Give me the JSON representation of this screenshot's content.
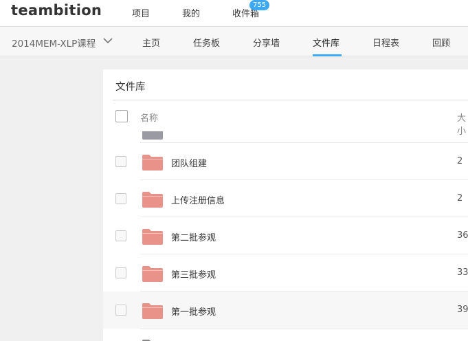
{
  "app": {
    "logo": "teambition"
  },
  "topnav": {
    "items": [
      "项目",
      "我的",
      "收件箱"
    ],
    "inbox_badge": "755"
  },
  "project": {
    "name": "2014MEM-XLP课程",
    "tabs": [
      "主页",
      "任务板",
      "分享墙",
      "文件库",
      "日程表",
      "回顾"
    ],
    "active_tab": "文件库"
  },
  "library": {
    "title": "文件库",
    "columns": {
      "name": "名称",
      "size": "大小"
    },
    "rows": [
      {
        "name": "团队组建",
        "size": "2"
      },
      {
        "name": "上传注册信息",
        "size": "2"
      },
      {
        "name": "第二批参观",
        "size": "36"
      },
      {
        "name": "第三批参观",
        "size": "33"
      },
      {
        "name": "第一批参观",
        "size": "39"
      }
    ]
  },
  "colors": {
    "accent": "#3da8f5",
    "folder": "#e8928a",
    "folder_partial": "#9a9aa3"
  }
}
